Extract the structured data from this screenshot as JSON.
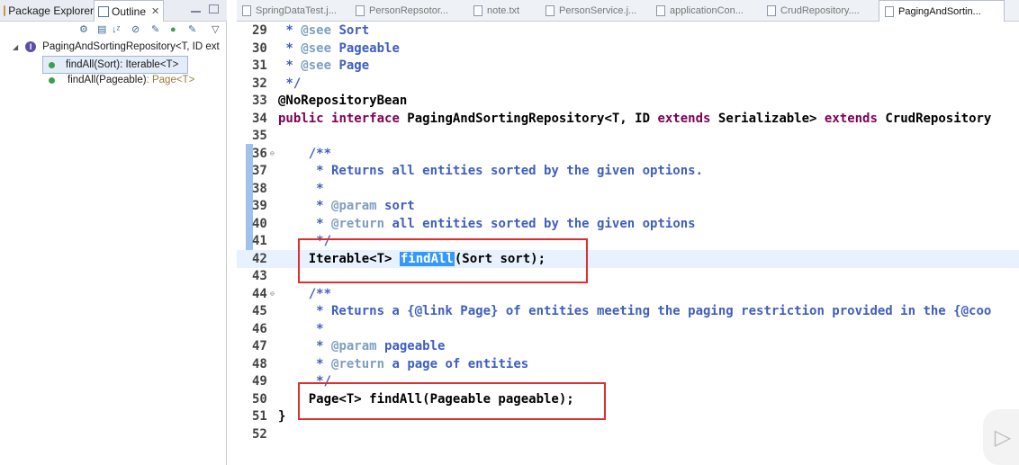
{
  "left_tabs": [
    {
      "label": "Package Explorer",
      "icon": "package-explorer-icon"
    },
    {
      "label": "Outline",
      "icon": "outline-icon"
    }
  ],
  "outline_toolbar_icons": [
    "focus-icon",
    "collapse-all-icon",
    "sort-icon",
    "hide-fields-icon",
    "hide-static-icon",
    "hide-nonpublic-icon",
    "hide-local-types-icon",
    "view-menu-icon"
  ],
  "tree": {
    "root": "PagingAndSortingRepository<T, ID ext",
    "items": [
      {
        "name": "findAll(Sort)",
        "ret": " : Iterable<T>"
      },
      {
        "name": "findAll(Pageable)",
        "ret": " : Page<T>"
      }
    ]
  },
  "editor_tabs": [
    "SpringDataTest.j...",
    "PersonRepsotor...",
    "note.txt",
    "PersonService.j...",
    "applicationCon...",
    "CrudRepository....",
    "PagingAndSortin..."
  ],
  "code_lines": [
    {
      "n": "29",
      "t": " * @see Sort"
    },
    {
      "n": "30",
      "t": " * @see Pageable"
    },
    {
      "n": "31",
      "t": " * @see Page"
    },
    {
      "n": "32",
      "t": " */"
    },
    {
      "n": "33",
      "t": "@NoRepositoryBean"
    },
    {
      "n": "34",
      "t": "public interface PagingAndSortingRepository<T, ID extends Serializable> extends CrudRepository"
    },
    {
      "n": "35",
      "t": ""
    },
    {
      "n": "36",
      "t": "    /**"
    },
    {
      "n": "37",
      "t": "     * Returns all entities sorted by the given options."
    },
    {
      "n": "38",
      "t": "     *"
    },
    {
      "n": "39",
      "t": "     * @param sort"
    },
    {
      "n": "40",
      "t": "     * @return all entities sorted by the given options"
    },
    {
      "n": "41",
      "t": "     */"
    },
    {
      "n": "42",
      "t": "    Iterable<T> findAll(Sort sort);"
    },
    {
      "n": "43",
      "t": ""
    },
    {
      "n": "44",
      "t": "    /**"
    },
    {
      "n": "45",
      "t": "     * Returns a {@link Page} of entities meeting the paging restriction provided in the {@coo"
    },
    {
      "n": "46",
      "t": "     *"
    },
    {
      "n": "47",
      "t": "     * @param pageable"
    },
    {
      "n": "48",
      "t": "     * @return a page of entities"
    },
    {
      "n": "49",
      "t": "     */"
    },
    {
      "n": "50",
      "t": "    Page<T> findAll(Pageable pageable);"
    },
    {
      "n": "51",
      "t": "}"
    },
    {
      "n": "52",
      "t": ""
    }
  ],
  "highlighted_word": "findAll",
  "colors": {
    "keyword": "#7f0055",
    "javadoc": "#3f5fbf",
    "javadoc_tag": "#7f9fbf",
    "annotation_box": "#e02d2d",
    "selection": "#3399ff"
  }
}
